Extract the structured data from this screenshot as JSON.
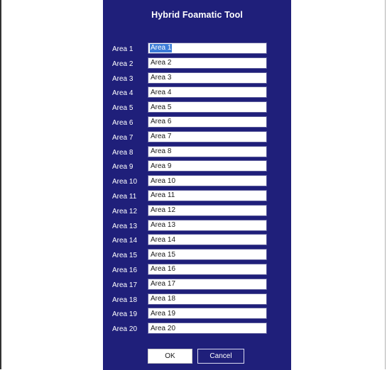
{
  "dialog": {
    "title": "Hybrid Foamatic Tool",
    "colors": {
      "background": "#1f1f7a",
      "label": "#ffffff",
      "selection": "#3b7bd8"
    },
    "areas": [
      {
        "label": "Area 1",
        "value": "Area 1"
      },
      {
        "label": "Area 2",
        "value": "Area 2"
      },
      {
        "label": "Area 3",
        "value": "Area 3"
      },
      {
        "label": "Area 4",
        "value": "Area 4"
      },
      {
        "label": "Area 5",
        "value": "Area 5"
      },
      {
        "label": "Area 6",
        "value": "Area 6"
      },
      {
        "label": "Area 7",
        "value": "Area 7"
      },
      {
        "label": "Area 8",
        "value": "Area 8"
      },
      {
        "label": "Area 9",
        "value": "Area 9"
      },
      {
        "label": "Area 10",
        "value": "Area 10"
      },
      {
        "label": "Area 11",
        "value": "Area 11"
      },
      {
        "label": "Area 12",
        "value": "Area 12"
      },
      {
        "label": "Area 13",
        "value": "Area 13"
      },
      {
        "label": "Area 14",
        "value": "Area 14"
      },
      {
        "label": "Area 15",
        "value": "Area 15"
      },
      {
        "label": "Area 16",
        "value": "Area 16"
      },
      {
        "label": "Area 17",
        "value": "Area 17"
      },
      {
        "label": "Area 18",
        "value": "Area 18"
      },
      {
        "label": "Area 19",
        "value": "Area 19"
      },
      {
        "label": "Area 20",
        "value": "Area 20"
      }
    ],
    "buttons": {
      "ok_label": "OK",
      "cancel_label": "Cancel"
    }
  }
}
